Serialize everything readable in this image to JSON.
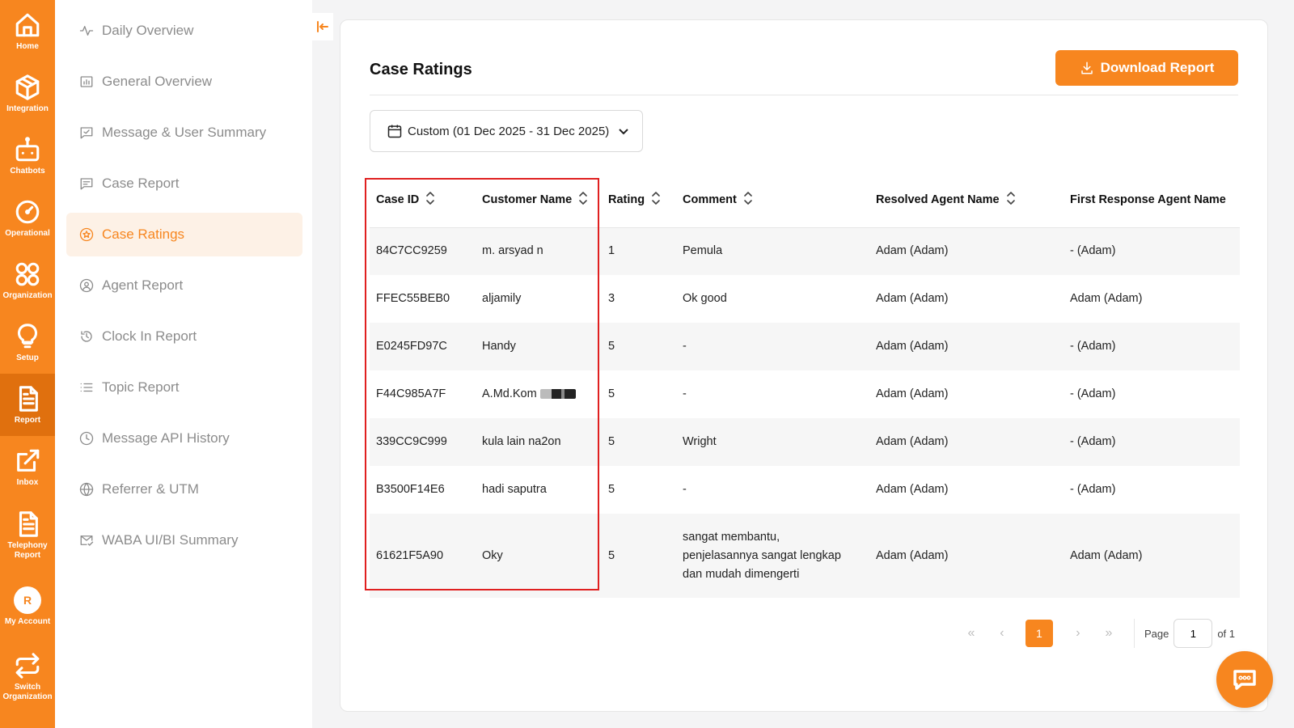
{
  "rail": {
    "items": [
      {
        "label": "Home",
        "icon": "home-icon"
      },
      {
        "label": "Integration",
        "icon": "cube-icon"
      },
      {
        "label": "Chatbots",
        "icon": "robot-icon"
      },
      {
        "label": "Operational",
        "icon": "gauge-icon"
      },
      {
        "label": "Organization",
        "icon": "grid-circles-icon"
      },
      {
        "label": "Setup",
        "icon": "lightbulb-icon"
      },
      {
        "label": "Report",
        "icon": "document-icon"
      },
      {
        "label": "Inbox",
        "icon": "external-link-icon"
      },
      {
        "label": "Telephony Report",
        "icon": "document-icon"
      },
      {
        "label": "My Account",
        "icon": "avatar-icon",
        "avatar": "R"
      },
      {
        "label": "Switch Organization",
        "icon": "switch-icon"
      }
    ],
    "active": "Report"
  },
  "subnav": {
    "items": [
      {
        "label": "Daily Overview",
        "icon": "pulse-icon"
      },
      {
        "label": "General Overview",
        "icon": "bar-chart-icon"
      },
      {
        "label": "Message & User Summary",
        "icon": "message-check-icon"
      },
      {
        "label": "Case Report",
        "icon": "message-lines-icon"
      },
      {
        "label": "Case Ratings",
        "icon": "star-circle-icon"
      },
      {
        "label": "Agent Report",
        "icon": "user-circle-icon"
      },
      {
        "label": "Clock In Report",
        "icon": "clock-in-icon"
      },
      {
        "label": "Topic Report",
        "icon": "list-icon"
      },
      {
        "label": "Message API History",
        "icon": "clock-icon"
      },
      {
        "label": "Referrer & UTM",
        "icon": "globe-icon"
      },
      {
        "label": "WABA UI/BI Summary",
        "icon": "mail-check-icon"
      }
    ],
    "active": "Case Ratings"
  },
  "page": {
    "title": "Case Ratings",
    "download_label": "Download Report",
    "date_filter": "Custom (01 Dec 2025 - 31 Dec 2025)"
  },
  "table": {
    "headers": [
      "Case ID",
      "Customer Name",
      "Rating",
      "Comment",
      "Resolved Agent Name",
      "First Response Agent Name"
    ],
    "rows": [
      {
        "case_id": "84C7CC9259",
        "customer": "m. arsyad n",
        "rating": "1",
        "comment": "Pemula",
        "resolved": "Adam (Adam)",
        "first": "- (Adam)"
      },
      {
        "case_id": "FFEC55BEB0",
        "customer": "aljamily",
        "rating": "3",
        "comment": "Ok good",
        "resolved": "Adam (Adam)",
        "first": "Adam (Adam)"
      },
      {
        "case_id": "E0245FD97C",
        "customer": "Handy",
        "rating": "5",
        "comment": "-",
        "resolved": "Adam (Adam)",
        "first": "- (Adam)"
      },
      {
        "case_id": "F44C985A7F",
        "customer": "A.Md.Kom",
        "rating": "5",
        "comment": "-",
        "resolved": "Adam (Adam)",
        "first": "- (Adam)"
      },
      {
        "case_id": "339CC9C999",
        "customer": "kula lain na2on",
        "rating": "5",
        "comment": "Wright",
        "resolved": "Adam (Adam)",
        "first": "- (Adam)"
      },
      {
        "case_id": "B3500F14E6",
        "customer": "hadi saputra",
        "rating": "5",
        "comment": "-",
        "resolved": "Adam (Adam)",
        "first": "- (Adam)"
      },
      {
        "case_id": "61621F5A90",
        "customer": "Oky",
        "rating": "5",
        "comment": "sangat membantu, penjelasannya sangat lengkap dan mudah dimengerti",
        "resolved": "Adam (Adam)",
        "first": "Adam (Adam)"
      }
    ]
  },
  "pagination": {
    "current": "1",
    "page_label": "Page",
    "page_input": "1",
    "of_label": "of 1"
  },
  "colors": {
    "accent": "#f7861f",
    "highlight": "#e02020"
  }
}
